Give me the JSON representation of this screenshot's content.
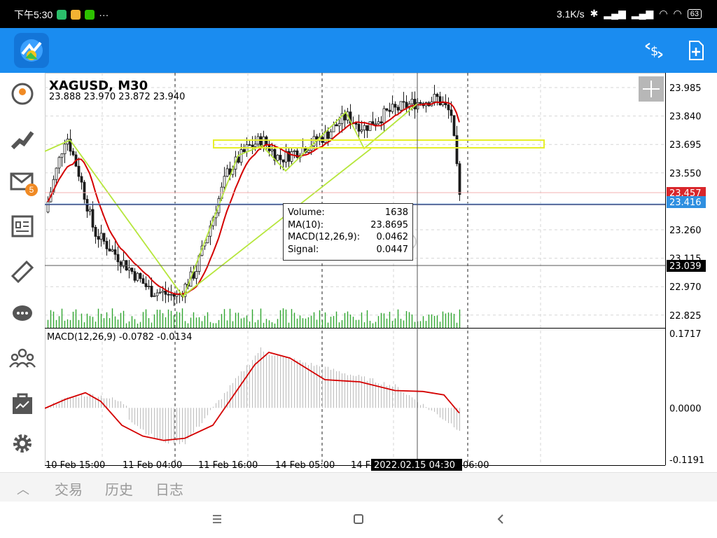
{
  "status_bar": {
    "time": "下午5:30",
    "more": "···",
    "network_speed": "3.1K/s",
    "battery": "63"
  },
  "app_bar": {
    "logo_icon": "metatrader-logo-icon",
    "actions": [
      "trade-dollar-icon",
      "new-order-icon"
    ]
  },
  "sidebar": {
    "items": [
      {
        "icon": "quotes-icon"
      },
      {
        "icon": "charts-icon"
      },
      {
        "icon": "mail-icon",
        "badge": "5"
      },
      {
        "icon": "news-icon"
      },
      {
        "icon": "tradays-icon"
      },
      {
        "icon": "chat-icon"
      },
      {
        "icon": "community-icon"
      },
      {
        "icon": "market-icon"
      },
      {
        "icon": "settings-icon"
      }
    ]
  },
  "chart": {
    "symbol": "XAGUSD, M30",
    "ohlc": "23.888 23.970 23.872 23.940",
    "price_axis": [
      "23.985",
      "23.840",
      "23.695",
      "23.550",
      "23.260",
      "23.115",
      "22.970",
      "22.825"
    ],
    "bid_price": "23.457",
    "ask_price": "23.416",
    "crosshair_price": "23.039",
    "macd_label": "MACD(12,26,9) -0.0782 -0.0134",
    "macd_axis": [
      "0.1717",
      "0.0000",
      "-0.1191"
    ],
    "time_axis": [
      "10 Feb 15:00",
      "11 Feb 04:00",
      "11 Feb 16:00",
      "14 Feb 05:00",
      "14 F",
      "06:00"
    ],
    "crosshair_time": "2022.02.15 04:30",
    "tooltip": {
      "volume_label": "Volume:",
      "volume_value": "1638",
      "ma_label": "MA(10):",
      "ma_value": "23.8695",
      "macd_label": "MACD(12,26,9):",
      "macd_value": "0.0462",
      "signal_label": "Signal:",
      "signal_value": "0.0447"
    },
    "colors": {
      "bid_line": "#d9262b",
      "ask_line": "#2f8fe0",
      "ma_line": "#d40000",
      "trend_lines": "#b6e63c",
      "rectangle": "#e6ef2a",
      "candles": "#1b1b1b",
      "volume": "#2fa52f",
      "macd_hist": "#bbbbbb",
      "macd_signal": "#d40000"
    }
  },
  "chart_data": {
    "type": "candlestick",
    "symbol": "XAGUSD",
    "timeframe": "M30",
    "ylim": [
      22.76,
      24.06
    ],
    "series_summary": [
      {
        "time": "10 Feb 15:00",
        "approx_close": 23.45
      },
      {
        "time": "11 Feb 04:00",
        "approx_close": 22.95
      },
      {
        "time": "11 Feb 16:00",
        "approx_close": 23.62
      },
      {
        "time": "14 Feb 05:00",
        "approx_close": 23.72
      },
      {
        "time": "2022.02.15 04:30",
        "approx_close": 23.94
      },
      {
        "time": "06:00",
        "approx_close": 23.42
      }
    ],
    "macd_ylim": [
      -0.1191,
      0.1717
    ]
  },
  "bottom_tabs": [
    "交易",
    "历史",
    "日志"
  ],
  "nav_bar": [
    "recent-apps-icon",
    "home-icon",
    "back-icon"
  ]
}
